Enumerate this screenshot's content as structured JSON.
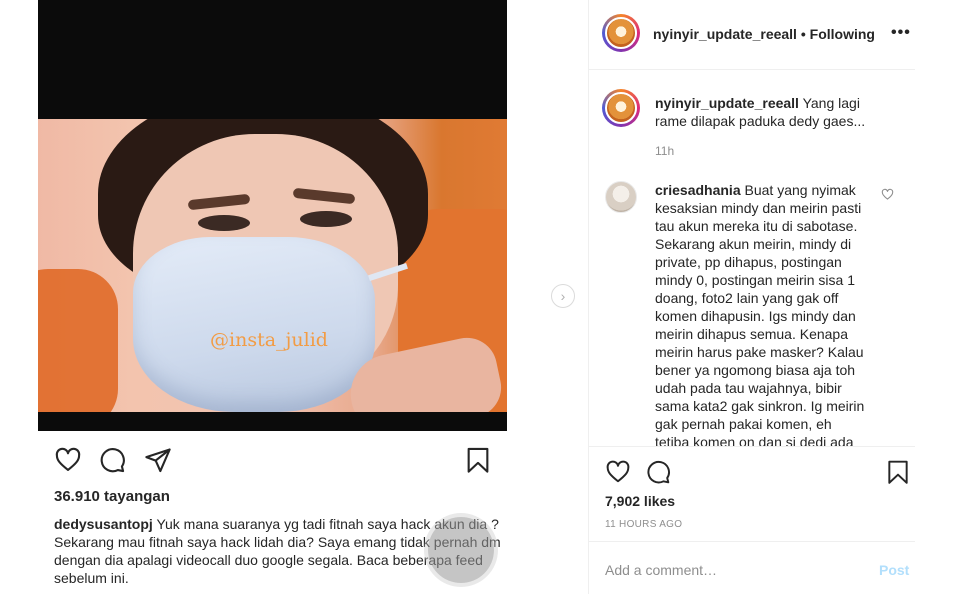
{
  "video": {
    "watermark": "@insta_julid"
  },
  "embedded_post": {
    "views": "36.910 tayangan",
    "caption_user": "dedysusantopj",
    "caption_text": "Yuk mana suaranya yg tadi fitnah saya hack akun dia ? Sekarang mau fitnah saya hack lidah dia? Saya emang tidak pernah dm dengan dia apalagi videocall duo google segala. Baca beberapa feed sebelum ini."
  },
  "header": {
    "username": "nyinyir_update_reeall",
    "separator": " • ",
    "follow_status": "Following",
    "more": "•••"
  },
  "owner_post": {
    "username": "nyinyir_update_reeall",
    "caption": "Yang lagi rame dilapak paduka dedy gaes...",
    "time": "11h"
  },
  "comments": [
    {
      "username": "criesadhania",
      "text": "Buat yang nyimak kesaksian mindy dan meirin pasti tau akun mereka itu di sabotase. Sekarang akun meirin, mindy di private, pp dihapus, postingan mindy 0, postingan meirin sisa 1 doang, foto2 lain yang gak off komen dihapusin. Igs mindy dan meirin dihapus semua. Kenapa meirin harus pake masker? Kalau bener ya ngomong biasa aja toh udah pada tau wajahnya, bibir sama kata2 gak sinkron. Ig meirin gak pernah pakai komen, eh tetiba komen on dan si dedi ada"
    }
  ],
  "actions": {
    "likes": "7,902 likes",
    "time_ago": "11 HOURS AGO"
  },
  "comment_box": {
    "placeholder": "Add a comment…",
    "post_label": "Post"
  },
  "colors": {
    "post_button_disabled": "#b2dffc",
    "secondary_text": "#8e8e8e",
    "watermark": "#f29c45"
  }
}
